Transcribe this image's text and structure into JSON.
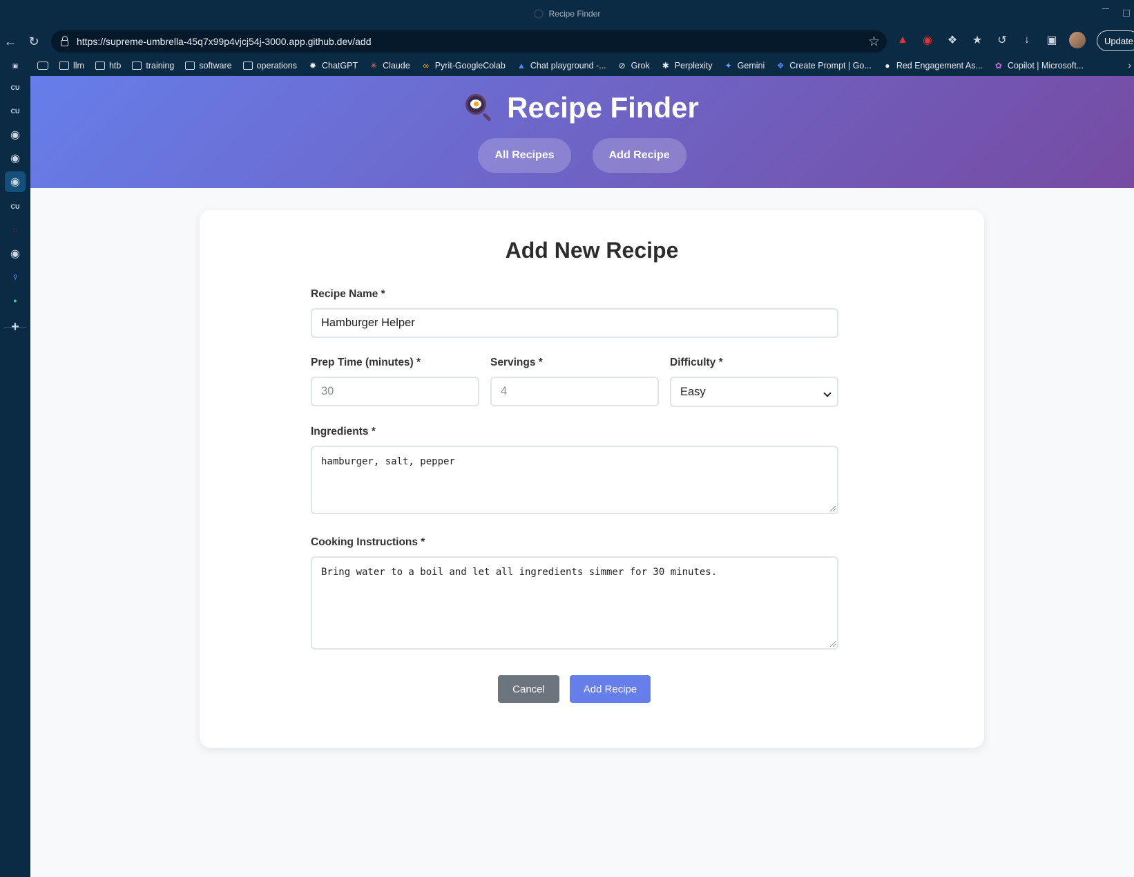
{
  "window": {
    "title": "Recipe Finder"
  },
  "browser": {
    "url": "https://supreme-umbrella-45q7x99p4vjcj54j-3000.app.github.dev/add",
    "update_label": "Update",
    "bookmarks": [
      {
        "label": "llm",
        "icon": "folder-icon"
      },
      {
        "label": "htb",
        "icon": "folder-icon"
      },
      {
        "label": "training",
        "icon": "folder-icon"
      },
      {
        "label": "software",
        "icon": "folder-icon"
      },
      {
        "label": "operations",
        "icon": "folder-icon"
      },
      {
        "label": "ChatGPT",
        "icon": "chatgpt-icon"
      },
      {
        "label": "Claude",
        "icon": "claude-icon"
      },
      {
        "label": "Pyrit-GoogleColab",
        "icon": "colab-icon"
      },
      {
        "label": "Chat playground -...",
        "icon": "playground-icon"
      },
      {
        "label": "Grok",
        "icon": "grok-icon"
      },
      {
        "label": "Perplexity",
        "icon": "perplexity-icon"
      },
      {
        "label": "Gemini",
        "icon": "gemini-icon"
      },
      {
        "label": "Create Prompt | Go...",
        "icon": "prompt-icon"
      },
      {
        "label": "Red Engagement As...",
        "icon": "red-engagement-icon"
      },
      {
        "label": "Copilot | Microsoft...",
        "icon": "copilot-icon"
      }
    ],
    "sidebar_labels": {
      "cu": "CU"
    }
  },
  "app": {
    "title": "Recipe Finder",
    "nav": {
      "all_recipes": "All Recipes",
      "add_recipe": "Add Recipe"
    },
    "form": {
      "heading": "Add New Recipe",
      "name_label": "Recipe Name *",
      "name_value": "Hamburger Helper",
      "prep_label": "Prep Time (minutes) *",
      "prep_placeholder": "30",
      "servings_label": "Servings *",
      "servings_placeholder": "4",
      "difficulty_label": "Difficulty *",
      "difficulty_value": "Easy",
      "ingredients_label": "Ingredients *",
      "ingredients_value": "hamburger, salt, pepper",
      "instructions_label": "Cooking Instructions *",
      "instructions_value": "Bring water to a boil and let all ingredients simmer for 30 minutes.",
      "cancel_label": "Cancel",
      "submit_label": "Add Recipe"
    },
    "colors": {
      "gradient_start": "#667eea",
      "gradient_end": "#764ba2",
      "cancel": "#6c757d",
      "submit": "#667eea"
    }
  }
}
